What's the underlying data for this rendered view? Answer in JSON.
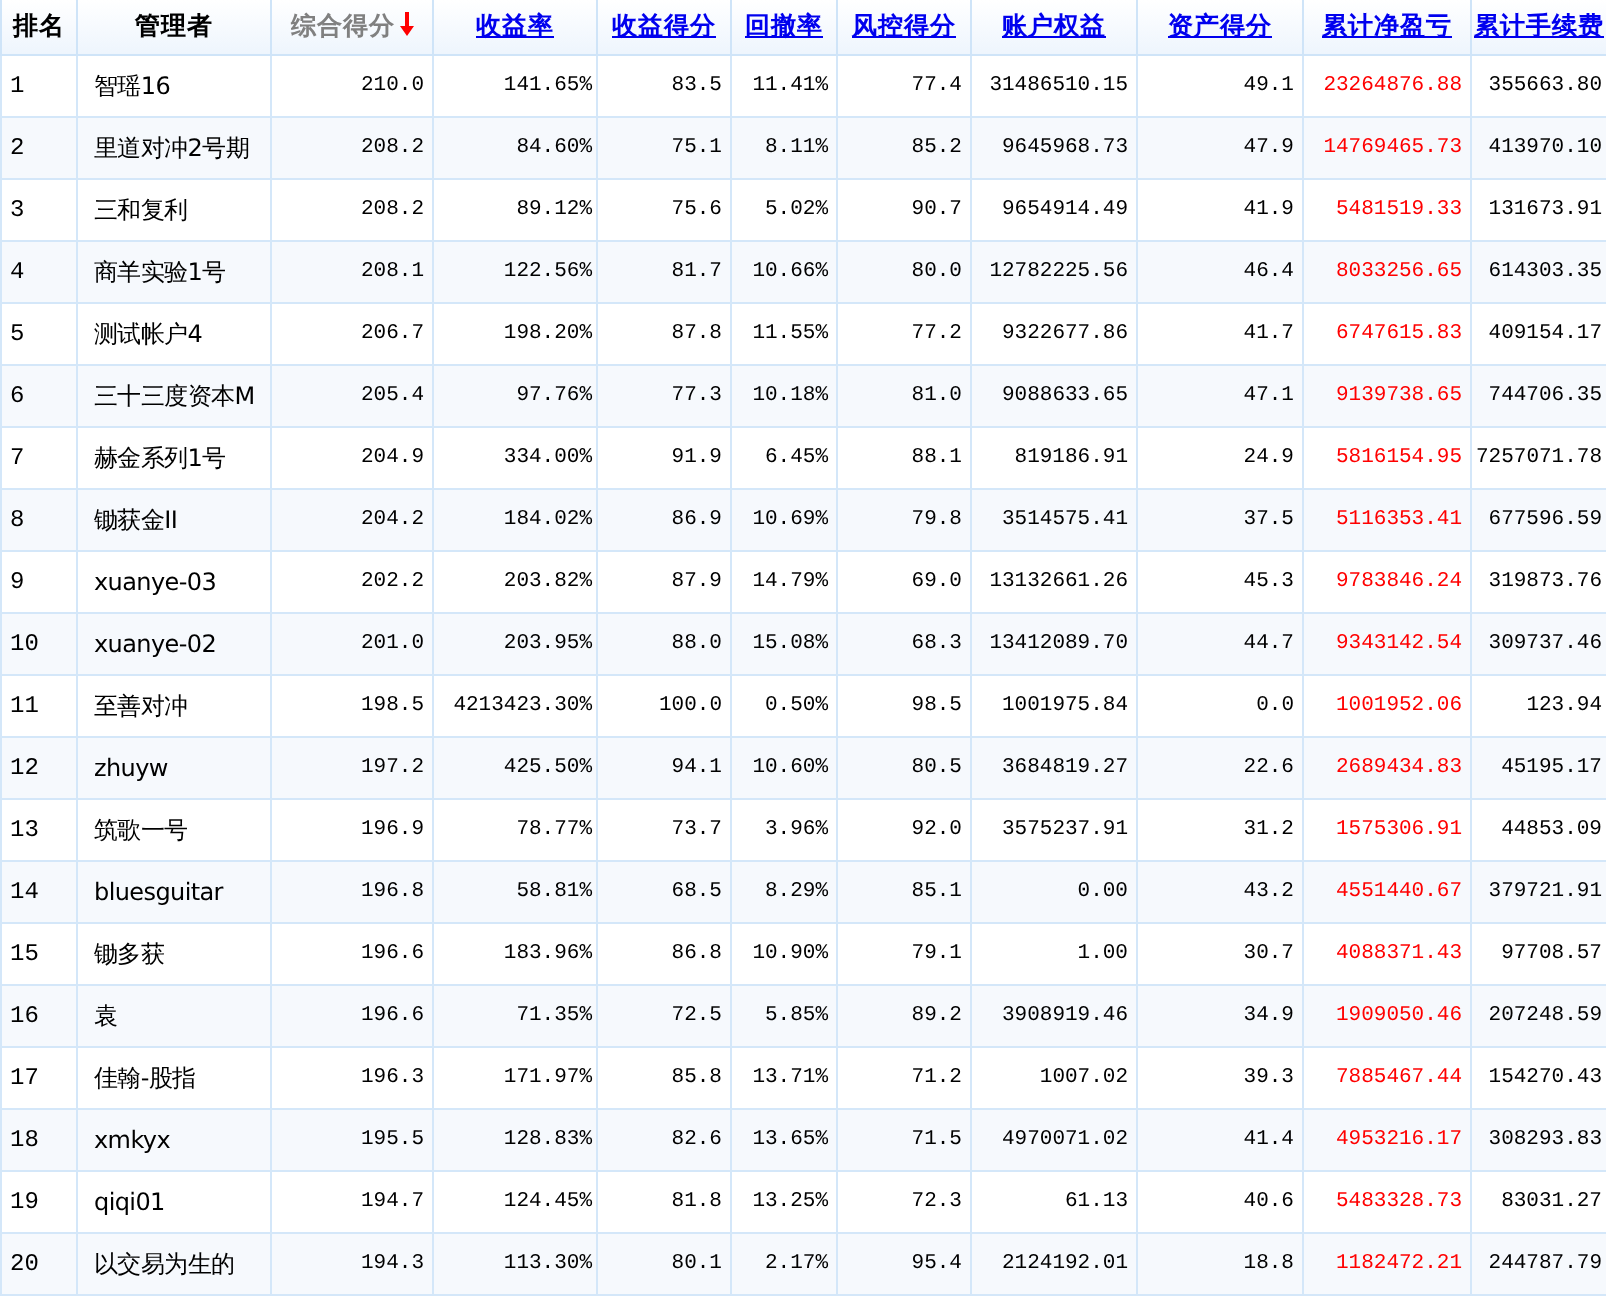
{
  "table": {
    "columns": [
      {
        "label": "排名",
        "kind": "plain",
        "selected": false,
        "emphasis": false
      },
      {
        "label": "管理者",
        "kind": "plain",
        "selected": false,
        "emphasis": false
      },
      {
        "label": "综合得分",
        "kind": "link",
        "selected": true,
        "emphasis": false
      },
      {
        "label": "收益率",
        "kind": "link",
        "selected": false,
        "emphasis": false
      },
      {
        "label": "收益得分",
        "kind": "link",
        "selected": false,
        "emphasis": false
      },
      {
        "label": "回撤率",
        "kind": "link",
        "selected": false,
        "emphasis": false
      },
      {
        "label": "风控得分",
        "kind": "link",
        "selected": false,
        "emphasis": false
      },
      {
        "label": "账户权益",
        "kind": "link",
        "selected": false,
        "emphasis": false
      },
      {
        "label": "资产得分",
        "kind": "link",
        "selected": false,
        "emphasis": false
      },
      {
        "label": "累计净盈亏",
        "kind": "link",
        "selected": false,
        "emphasis": true
      },
      {
        "label": "累计手续费",
        "kind": "link",
        "selected": false,
        "emphasis": false
      }
    ],
    "rows": [
      [
        "1",
        "智瑶16",
        "210.0",
        "141.65%",
        "83.5",
        "11.41%",
        "77.4",
        "31486510.15",
        "49.1",
        "23264876.88",
        "355663.80"
      ],
      [
        "2",
        "里道对冲2号期",
        "208.2",
        "84.60%",
        "75.1",
        "8.11%",
        "85.2",
        "9645968.73",
        "47.9",
        "14769465.73",
        "413970.10"
      ],
      [
        "3",
        "三和复利",
        "208.2",
        "89.12%",
        "75.6",
        "5.02%",
        "90.7",
        "9654914.49",
        "41.9",
        "5481519.33",
        "131673.91"
      ],
      [
        "4",
        "商羊实验1号",
        "208.1",
        "122.56%",
        "81.7",
        "10.66%",
        "80.0",
        "12782225.56",
        "46.4",
        "8033256.65",
        "614303.35"
      ],
      [
        "5",
        "测试帐户4",
        "206.7",
        "198.20%",
        "87.8",
        "11.55%",
        "77.2",
        "9322677.86",
        "41.7",
        "6747615.83",
        "409154.17"
      ],
      [
        "6",
        "三十三度资本M",
        "205.4",
        "97.76%",
        "77.3",
        "10.18%",
        "81.0",
        "9088633.65",
        "47.1",
        "9139738.65",
        "744706.35"
      ],
      [
        "7",
        "赫金系列1号",
        "204.9",
        "334.00%",
        "91.9",
        "6.45%",
        "88.1",
        "819186.91",
        "24.9",
        "5816154.95",
        "7257071.78"
      ],
      [
        "8",
        "锄获金II",
        "204.2",
        "184.02%",
        "86.9",
        "10.69%",
        "79.8",
        "3514575.41",
        "37.5",
        "5116353.41",
        "677596.59"
      ],
      [
        "9",
        "xuanye-03",
        "202.2",
        "203.82%",
        "87.9",
        "14.79%",
        "69.0",
        "13132661.26",
        "45.3",
        "9783846.24",
        "319873.76"
      ],
      [
        "10",
        "xuanye-02",
        "201.0",
        "203.95%",
        "88.0",
        "15.08%",
        "68.3",
        "13412089.70",
        "44.7",
        "9343142.54",
        "309737.46"
      ],
      [
        "11",
        "至善对冲",
        "198.5",
        "4213423.30%",
        "100.0",
        "0.50%",
        "98.5",
        "1001975.84",
        "0.0",
        "1001952.06",
        "123.94"
      ],
      [
        "12",
        "zhuyw",
        "197.2",
        "425.50%",
        "94.1",
        "10.60%",
        "80.5",
        "3684819.27",
        "22.6",
        "2689434.83",
        "45195.17"
      ],
      [
        "13",
        "筑歌一号",
        "196.9",
        "78.77%",
        "73.7",
        "3.96%",
        "92.0",
        "3575237.91",
        "31.2",
        "1575306.91",
        "44853.09"
      ],
      [
        "14",
        "bluesguitar",
        "196.8",
        "58.81%",
        "68.5",
        "8.29%",
        "85.1",
        "0.00",
        "43.2",
        "4551440.67",
        "379721.91"
      ],
      [
        "15",
        "锄多获",
        "196.6",
        "183.96%",
        "86.8",
        "10.90%",
        "79.1",
        "1.00",
        "30.7",
        "4088371.43",
        "97708.57"
      ],
      [
        "16",
        "袁",
        "196.6",
        "71.35%",
        "72.5",
        "5.85%",
        "89.2",
        "3908919.46",
        "34.9",
        "1909050.46",
        "207248.59"
      ],
      [
        "17",
        "佳翰-股指",
        "196.3",
        "171.97%",
        "85.8",
        "13.71%",
        "71.2",
        "1007.02",
        "39.3",
        "7885467.44",
        "154270.43"
      ],
      [
        "18",
        "xmkyx",
        "195.5",
        "128.83%",
        "82.6",
        "13.65%",
        "71.5",
        "4970071.02",
        "41.4",
        "4953216.17",
        "308293.83"
      ],
      [
        "19",
        "qiqi01",
        "194.7",
        "124.45%",
        "81.8",
        "13.25%",
        "72.3",
        "61.13",
        "40.6",
        "5483328.73",
        "83031.27"
      ],
      [
        "20",
        "以交易为生的",
        "194.3",
        "113.30%",
        "80.1",
        "2.17%",
        "95.4",
        "2124192.01",
        "18.8",
        "1182472.21",
        "244787.79"
      ]
    ]
  }
}
